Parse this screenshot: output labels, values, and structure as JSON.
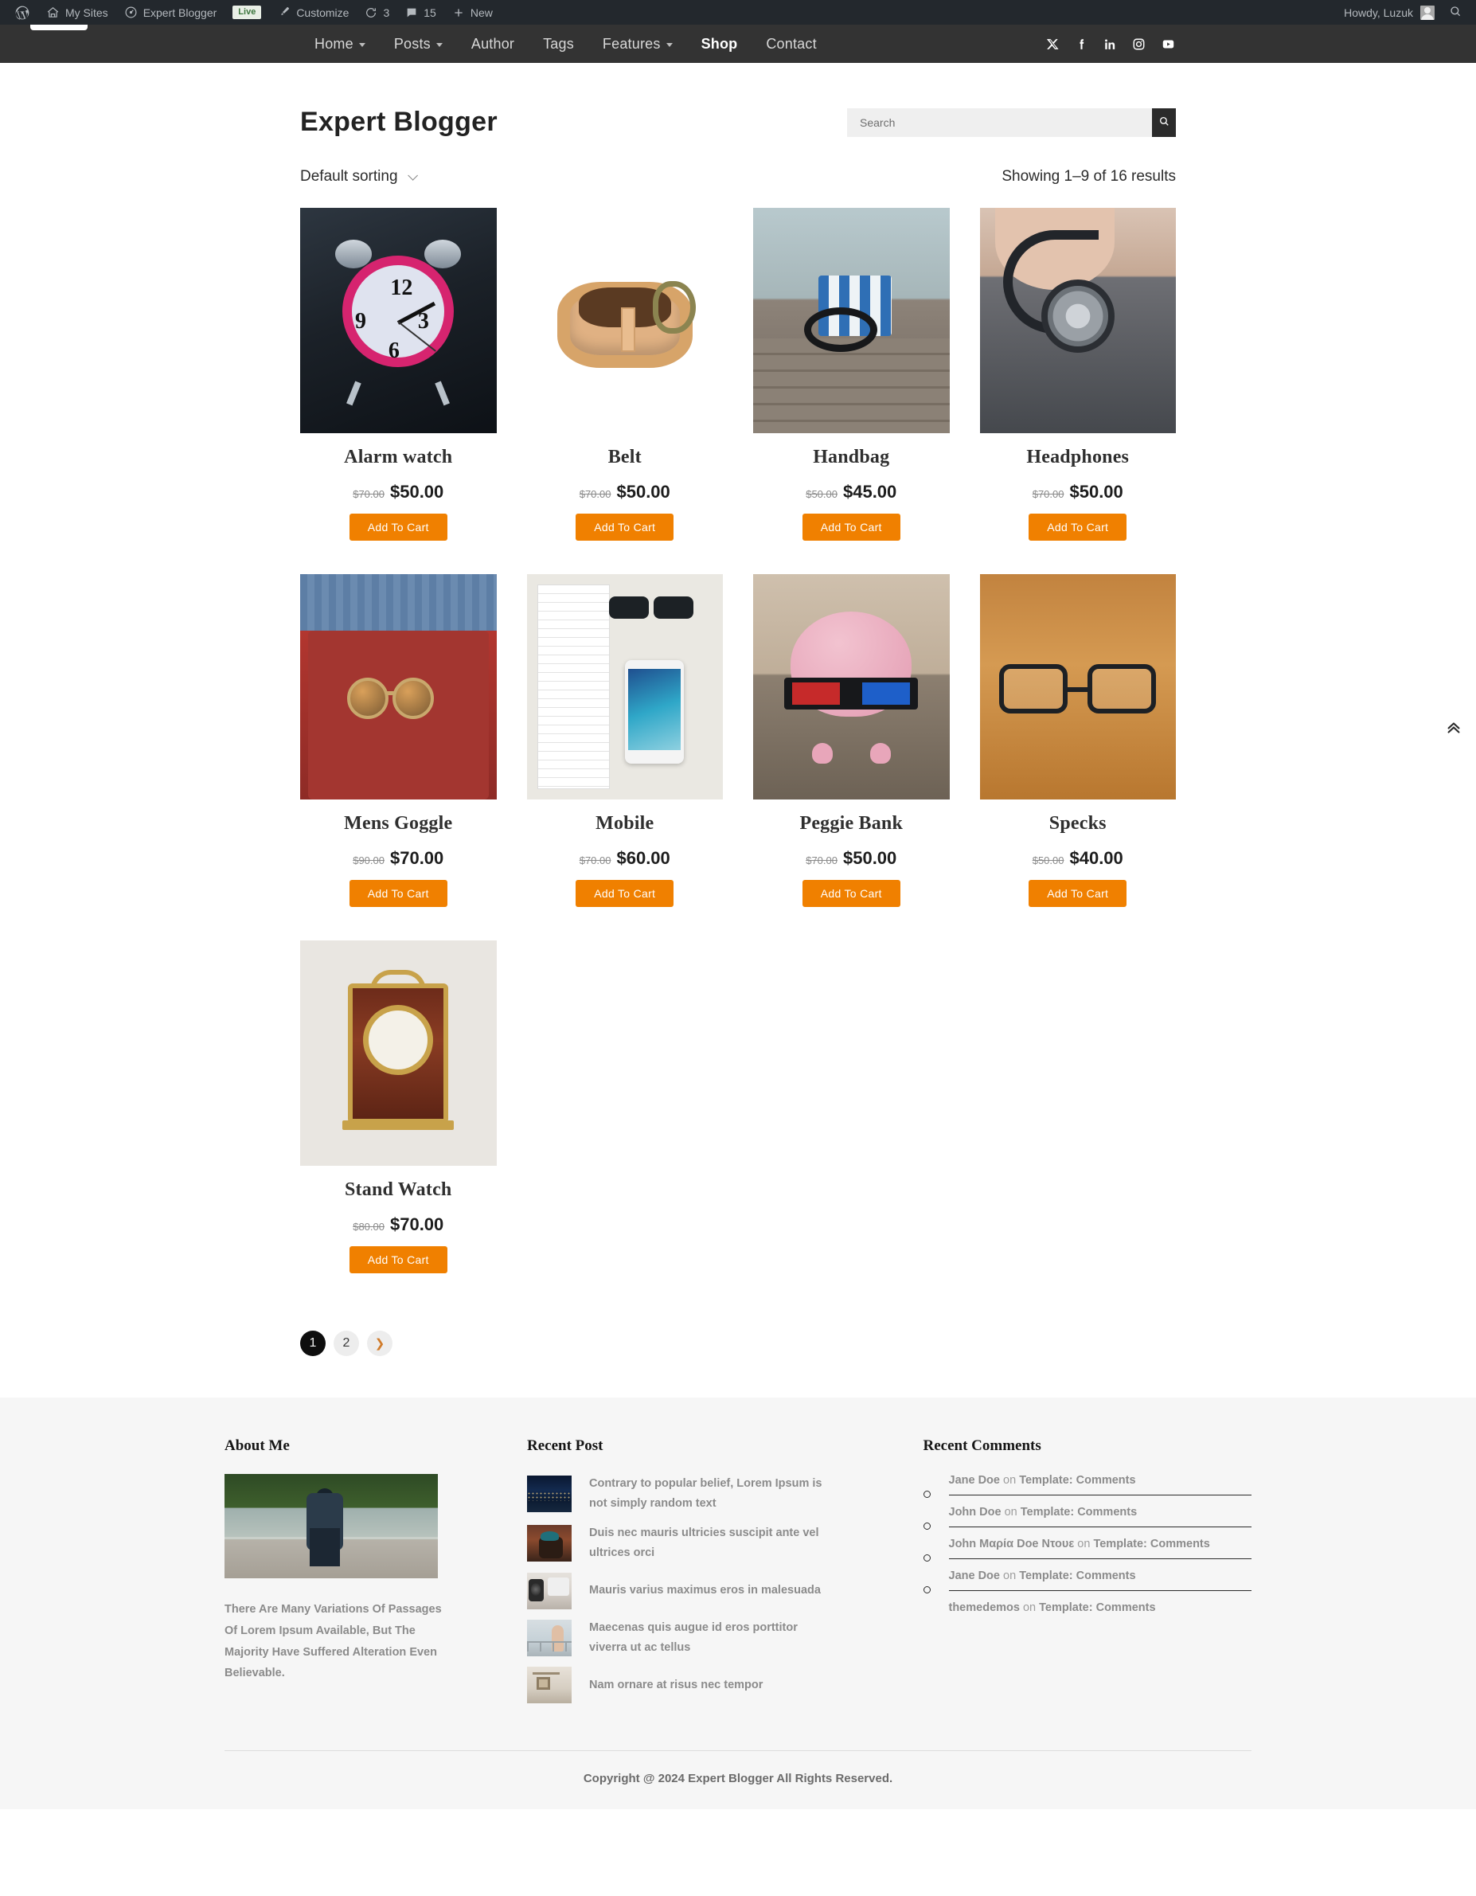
{
  "adminbar": {
    "items": [
      {
        "name": "wordpress-logo",
        "label": ""
      },
      {
        "name": "my-sites",
        "label": "My Sites"
      },
      {
        "name": "site-name",
        "label": "Expert Blogger"
      },
      {
        "name": "live-badge",
        "label": "Live"
      },
      {
        "name": "customize",
        "label": "Customize"
      },
      {
        "name": "updates",
        "label": "3"
      },
      {
        "name": "comments",
        "label": "15"
      },
      {
        "name": "new",
        "label": "New"
      }
    ],
    "my_sites": "My Sites",
    "site_name": "Expert Blogger",
    "live": "Live",
    "customize": "Customize",
    "updates_count": "3",
    "comments_count": "15",
    "new": "New",
    "howdy": "Howdy, Luzuk"
  },
  "nav": {
    "items": [
      {
        "label": "Home",
        "has_dropdown": true,
        "active": false
      },
      {
        "label": "Posts",
        "has_dropdown": true,
        "active": false
      },
      {
        "label": "Author",
        "has_dropdown": false,
        "active": false
      },
      {
        "label": "Tags",
        "has_dropdown": false,
        "active": false
      },
      {
        "label": "Features",
        "has_dropdown": true,
        "active": false
      },
      {
        "label": "Shop",
        "has_dropdown": false,
        "active": true
      },
      {
        "label": "Contact",
        "has_dropdown": false,
        "active": false
      }
    ],
    "social": [
      "x-icon",
      "facebook-icon",
      "linkedin-icon",
      "instagram-icon",
      "youtube-icon"
    ]
  },
  "header": {
    "site_title": "Expert Blogger",
    "search_placeholder": "Search",
    "search_value": ""
  },
  "shop": {
    "sorting_label": "Default sorting",
    "result_count": "Showing 1–9 of 16 results",
    "add_to_cart_label": "Add To Cart",
    "accent_color": "#f08000",
    "products": [
      {
        "name": "Alarm watch",
        "old_price": "$70.00",
        "price": "$50.00",
        "art": "art-alarm"
      },
      {
        "name": "Belt",
        "old_price": "$70.00",
        "price": "$50.00",
        "art": "art-belt"
      },
      {
        "name": "Handbag",
        "old_price": "$50.00",
        "price": "$45.00",
        "art": "art-handbag"
      },
      {
        "name": "Headphones",
        "old_price": "$70.00",
        "price": "$50.00",
        "art": "art-head"
      },
      {
        "name": "Mens Goggle",
        "old_price": "$90.00",
        "price": "$70.00",
        "art": "art-goggle"
      },
      {
        "name": "Mobile",
        "old_price": "$70.00",
        "price": "$60.00",
        "art": "art-mobile"
      },
      {
        "name": "Peggie Bank",
        "old_price": "$70.00",
        "price": "$50.00",
        "art": "art-peggie"
      },
      {
        "name": "Specks",
        "old_price": "$50.00",
        "price": "$40.00",
        "art": "art-specks"
      },
      {
        "name": "Stand Watch",
        "old_price": "$80.00",
        "price": "$70.00",
        "art": "art-stand"
      }
    ],
    "pagination": [
      {
        "label": "1",
        "type": "current"
      },
      {
        "label": "2",
        "type": "num"
      },
      {
        "label": "❯",
        "type": "next"
      }
    ]
  },
  "footer": {
    "about": {
      "title": "About Me",
      "text": "There Are Many Variations Of Passages Of Lorem Ipsum Available, But The Majority Have Suffered Alteration Even Believable."
    },
    "recent_post": {
      "title": "Recent Post",
      "items": [
        {
          "title": "Contrary to popular belief, Lorem Ipsum is not simply random text",
          "art": "art-city"
        },
        {
          "title": "Duis nec mauris ultricies suscipit ante vel ultrices orci",
          "art": "art-cafe"
        },
        {
          "title": "Mauris varius maximus eros in malesuada",
          "art": "art-desk"
        },
        {
          "title": "Maecenas quis augue id eros porttitor viverra ut ac tellus",
          "art": "art-roof"
        },
        {
          "title": "Nam ornare at risus nec tempor",
          "art": "art-room"
        }
      ]
    },
    "recent_comments": {
      "title": "Recent Comments",
      "on_word": "on",
      "items": [
        {
          "author": "Jane Doe",
          "post": "Template: Comments"
        },
        {
          "author": "John Doe",
          "post": "Template: Comments"
        },
        {
          "author": "John Μαρία Doe Ντουε",
          "post": "Template: Comments"
        },
        {
          "author": "Jane Doe",
          "post": "Template: Comments"
        },
        {
          "author": "themedemos",
          "post": "Template: Comments"
        }
      ]
    },
    "copyright": "Copyright @ 2024 Expert Blogger All Rights Reserved."
  },
  "scroll_top": {
    "name": "scroll-to-top-icon"
  }
}
